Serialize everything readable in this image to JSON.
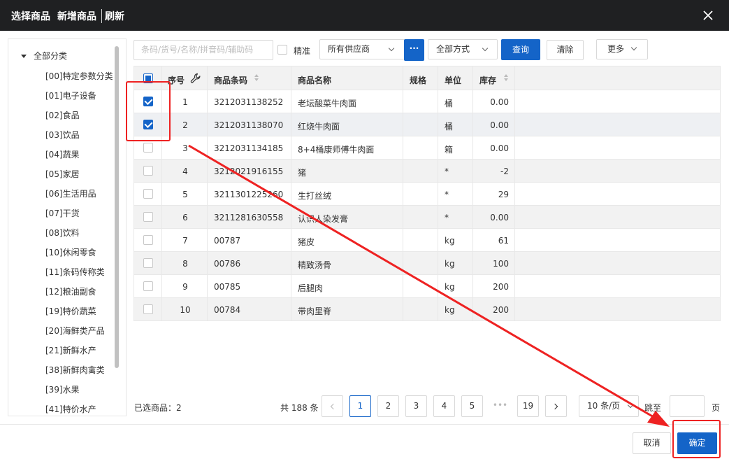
{
  "dialog": {
    "title_select": "选择商品",
    "title_new": "新增商品",
    "title_refresh": "刷新",
    "close_icon": "close-icon"
  },
  "sidebar": {
    "root": "全部分类",
    "items": [
      "[00]特定参数分类",
      "[01]电子设备",
      "[02]食品",
      "[03]饮品",
      "[04]蔬果",
      "[05]家居",
      "[06]生活用品",
      "[07]干货",
      "[08]饮料",
      "[10]休闲零食",
      "[11]条码传称类",
      "[12]粮油副食",
      "[19]特价蔬菜",
      "[20]海鲜类产品",
      "[21]新鲜水产",
      "[38]新鲜肉禽类",
      "[39]水果",
      "[41]特价水产"
    ]
  },
  "toolbar": {
    "search_placeholder": "条码/货号/名称/拼音码/辅助码",
    "precise_label": "精准",
    "supplier_value": "所有供应商",
    "dots_label": "···",
    "method_value": "全部方式",
    "query_label": "查询",
    "clear_label": "清除",
    "more_label": "更多"
  },
  "table": {
    "headers": {
      "seq": "序号",
      "barcode": "商品条码",
      "name": "商品名称",
      "spec": "规格",
      "unit": "单位",
      "stock": "库存"
    },
    "rows": [
      {
        "seq": "1",
        "barcode": "3212031138252",
        "name": "老坛酸菜牛肉面",
        "spec": "",
        "unit": "桶",
        "stock": "0.00",
        "checked": true
      },
      {
        "seq": "2",
        "barcode": "3212031138070",
        "name": "红烧牛肉面",
        "spec": "",
        "unit": "桶",
        "stock": "0.00",
        "checked": true
      },
      {
        "seq": "3",
        "barcode": "3212031134185",
        "name": "8+4桶康师傅牛肉面",
        "spec": "",
        "unit": "箱",
        "stock": "0.00",
        "checked": false
      },
      {
        "seq": "4",
        "barcode": "3212021916155",
        "name": "猪",
        "spec": "",
        "unit": "*",
        "stock": "-2",
        "checked": false
      },
      {
        "seq": "5",
        "barcode": "3211301225260",
        "name": "生打丝绒",
        "spec": "",
        "unit": "*",
        "stock": "29",
        "checked": false
      },
      {
        "seq": "6",
        "barcode": "3211281630558",
        "name": "认识人染发膏",
        "spec": "",
        "unit": "*",
        "stock": "0.00",
        "checked": false
      },
      {
        "seq": "7",
        "barcode": "00787",
        "name": "猪皮",
        "spec": "",
        "unit": "kg",
        "stock": "61",
        "checked": false
      },
      {
        "seq": "8",
        "barcode": "00786",
        "name": "精致汤骨",
        "spec": "",
        "unit": "kg",
        "stock": "100",
        "checked": false
      },
      {
        "seq": "9",
        "barcode": "00785",
        "name": "后腿肉",
        "spec": "",
        "unit": "kg",
        "stock": "200",
        "checked": false
      },
      {
        "seq": "10",
        "barcode": "00784",
        "name": "带肉里脊",
        "spec": "",
        "unit": "kg",
        "stock": "200",
        "checked": false
      }
    ]
  },
  "footer": {
    "selected_label": "已选商品：2",
    "total_label": "共 188 条",
    "pages": [
      "1",
      "2",
      "3",
      "4",
      "5",
      "•••",
      "19"
    ],
    "current_page": "1",
    "page_size": "10 条/页",
    "jump_label": "跳至",
    "jump_value": "",
    "page_unit": "页",
    "cancel_label": "取消",
    "ok_label": "确定"
  },
  "colors": {
    "primary": "#1464c8",
    "title_bg": "#1f2022",
    "annotation": "#ee2222"
  }
}
